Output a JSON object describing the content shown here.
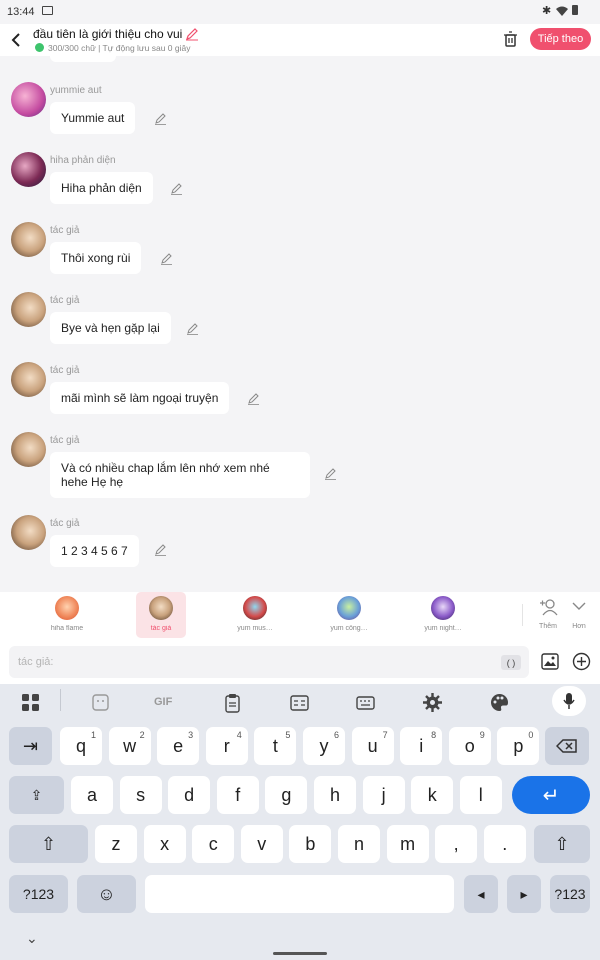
{
  "status": {
    "time": "13:44"
  },
  "header": {
    "title": "đầu tiên là giới thiệu cho vui",
    "subtitle": "300/300 chữ | Tự động lưu sau 0 giây",
    "next_label": "Tiếp theo"
  },
  "messages": [
    {
      "name": "yummie aut",
      "text": "Yummie aut"
    },
    {
      "name": "hiha phản diện",
      "text": "Hiha phản diện"
    },
    {
      "name": "tác giả",
      "text": "Thôi xong rùi"
    },
    {
      "name": "tác giả",
      "text": "Bye và hẹn gặp lại"
    },
    {
      "name": "tác giả",
      "text": "mãi mình sẽ làm ngoại truyện"
    },
    {
      "name": "tác giả",
      "text": "Và có nhiều chap lắm lên nhớ xem nhé hehe Hẹ hẹ"
    },
    {
      "name": "tác giả",
      "text": "1 2 3 4 5 6 7"
    }
  ],
  "characters": [
    {
      "label": "hiha flame"
    },
    {
      "label": "tác giả"
    },
    {
      "label": "yum mus…"
    },
    {
      "label": "yum công…"
    },
    {
      "label": "yum night…"
    }
  ],
  "charbar_actions": {
    "add_label": "Thêm",
    "more_label": "Hơn"
  },
  "input": {
    "placeholder": "tác giả:",
    "bracket_label": "( )"
  },
  "keyboard": {
    "row1": [
      {
        "k": "q",
        "n": "1"
      },
      {
        "k": "w",
        "n": "2"
      },
      {
        "k": "e",
        "n": "3"
      },
      {
        "k": "r",
        "n": "4"
      },
      {
        "k": "t",
        "n": "5"
      },
      {
        "k": "y",
        "n": "6"
      },
      {
        "k": "u",
        "n": "7"
      },
      {
        "k": "i",
        "n": "8"
      },
      {
        "k": "o",
        "n": "9"
      },
      {
        "k": "p",
        "n": "0"
      }
    ],
    "row2": [
      "a",
      "s",
      "d",
      "f",
      "g",
      "h",
      "j",
      "k",
      "l"
    ],
    "row3": [
      "z",
      "x",
      "c",
      "v",
      "b",
      "n",
      "m",
      ",",
      "."
    ],
    "sym_label": "?123",
    "gif_label": "GIF",
    "tab_glyph": "⇥",
    "caps_glyph": "⇪",
    "shift_glyph": "⇧",
    "enter_glyph": "↵",
    "emoji_glyph": "☺",
    "left_glyph": "◂",
    "right_glyph": "▸",
    "collapse_glyph": "⌄"
  },
  "colors": {
    "accent": "#f0506e",
    "enter": "#1a73e8",
    "check": "#3ec46d"
  }
}
